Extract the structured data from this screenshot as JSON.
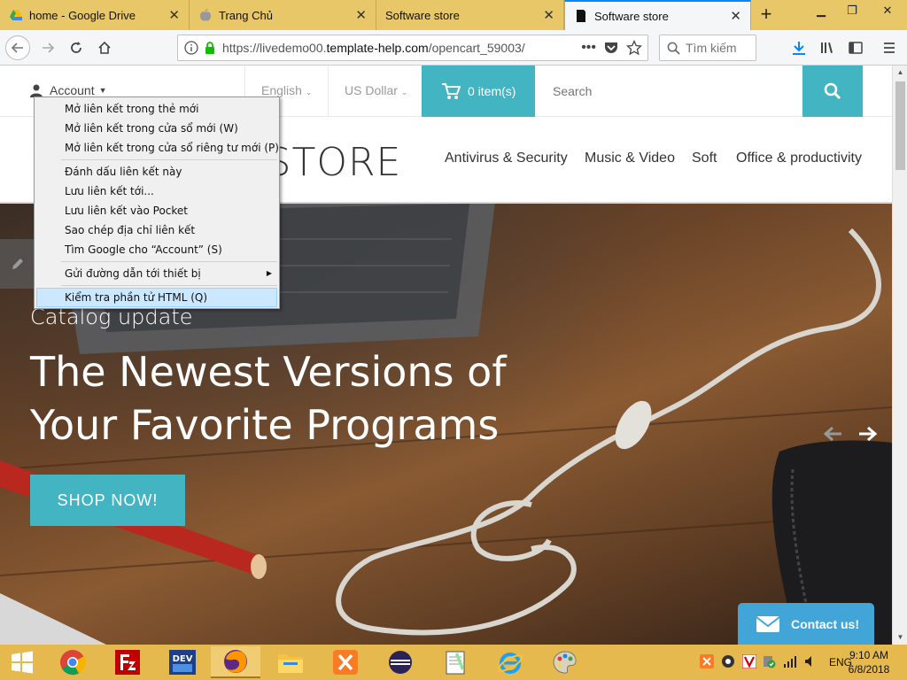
{
  "browser": {
    "tabs": [
      {
        "label": "home - Google Drive",
        "icon": "google-drive-icon"
      },
      {
        "label": "Trang Chủ",
        "icon": "apple-icon"
      },
      {
        "label": "Software store",
        "icon": "none"
      },
      {
        "label": "Software store",
        "icon": "page-icon",
        "active": true
      }
    ],
    "url_prefix": "https://livedemo00.",
    "url_domain": "template-help.com",
    "url_path": "/opencart_59003/",
    "search_placeholder": "Tìm kiếm"
  },
  "site": {
    "account_label": "Account",
    "language": "English",
    "currency": "US Dollar",
    "cart_label": "0 item(s)",
    "search_placeholder": "Search",
    "logo_text": "SOFTWARE STORE",
    "nav": [
      "Antivirus & Security",
      "Music & Video",
      "Soft",
      "Office & productivity"
    ],
    "hero": {
      "subtitle": "Catalog update",
      "title_line1": "The Newest Versions of",
      "title_line2": "Your Favorite Programs",
      "button": "SHOP NOW!"
    },
    "contact_label": "Contact us!",
    "accent_color": "#42b4c2"
  },
  "context_menu": {
    "items": [
      "Mở liên kết trong thẻ mới",
      "Mở liên kết trong cửa sổ mới (W)",
      "Mở liên kết trong cửa sổ riêng tư mới (P)",
      "Đánh dấu liên kết này",
      "Lưu liên kết tới...",
      "Lưu liên kết vào Pocket",
      "Sao chép địa chỉ liên kết",
      "Tìm Google cho “Account” (S)",
      "Gửi đường dẫn tới thiết bị",
      "Kiểm tra phần tử HTML (Q)"
    ]
  },
  "taskbar": {
    "lang": "ENG",
    "time": "9:10 AM",
    "date": "6/8/2018",
    "apps": [
      "windows-start-icon",
      "chrome-icon",
      "filezilla-icon",
      "devcpp-icon",
      "firefox-icon",
      "file-explorer-icon",
      "xampp-icon",
      "eclipse-icon",
      "notepad-plus-plus-icon",
      "internet-explorer-icon",
      "paint-icon"
    ]
  }
}
